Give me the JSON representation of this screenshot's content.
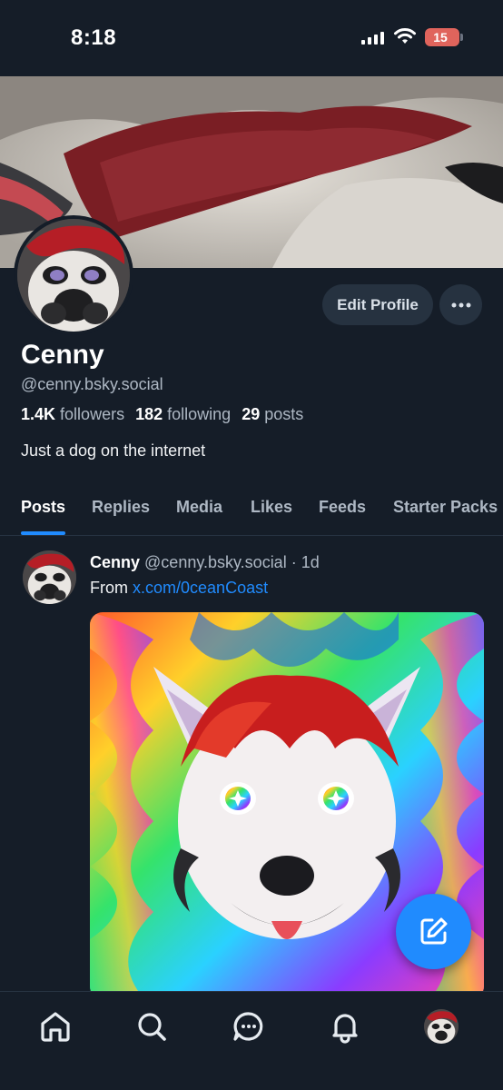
{
  "status_bar": {
    "time": "8:18",
    "battery": "15"
  },
  "profile": {
    "display_name": "Cenny",
    "handle": "@cenny.bsky.social",
    "followers_count": "1.4K",
    "followers_label": "followers",
    "following_count": "182",
    "following_label": "following",
    "posts_count": "29",
    "posts_label": "posts",
    "bio": "Just a dog on the internet",
    "edit_label": "Edit Profile"
  },
  "tabs": [
    {
      "label": "Posts",
      "active": true
    },
    {
      "label": "Replies"
    },
    {
      "label": "Media"
    },
    {
      "label": "Likes"
    },
    {
      "label": "Feeds"
    },
    {
      "label": "Starter Packs"
    }
  ],
  "post": {
    "author": "Cenny",
    "handle": "@cenny.bsky.social",
    "separator": "·",
    "time": "1d",
    "text_prefix": "From",
    "link": "x.com/0ceanCoast"
  },
  "nav": [
    "home-icon",
    "search-icon",
    "chat-icon",
    "bell-icon",
    "profile-avatar"
  ],
  "colors": {
    "background": "#151d28",
    "accent": "#208bfe",
    "button": "#263240"
  }
}
